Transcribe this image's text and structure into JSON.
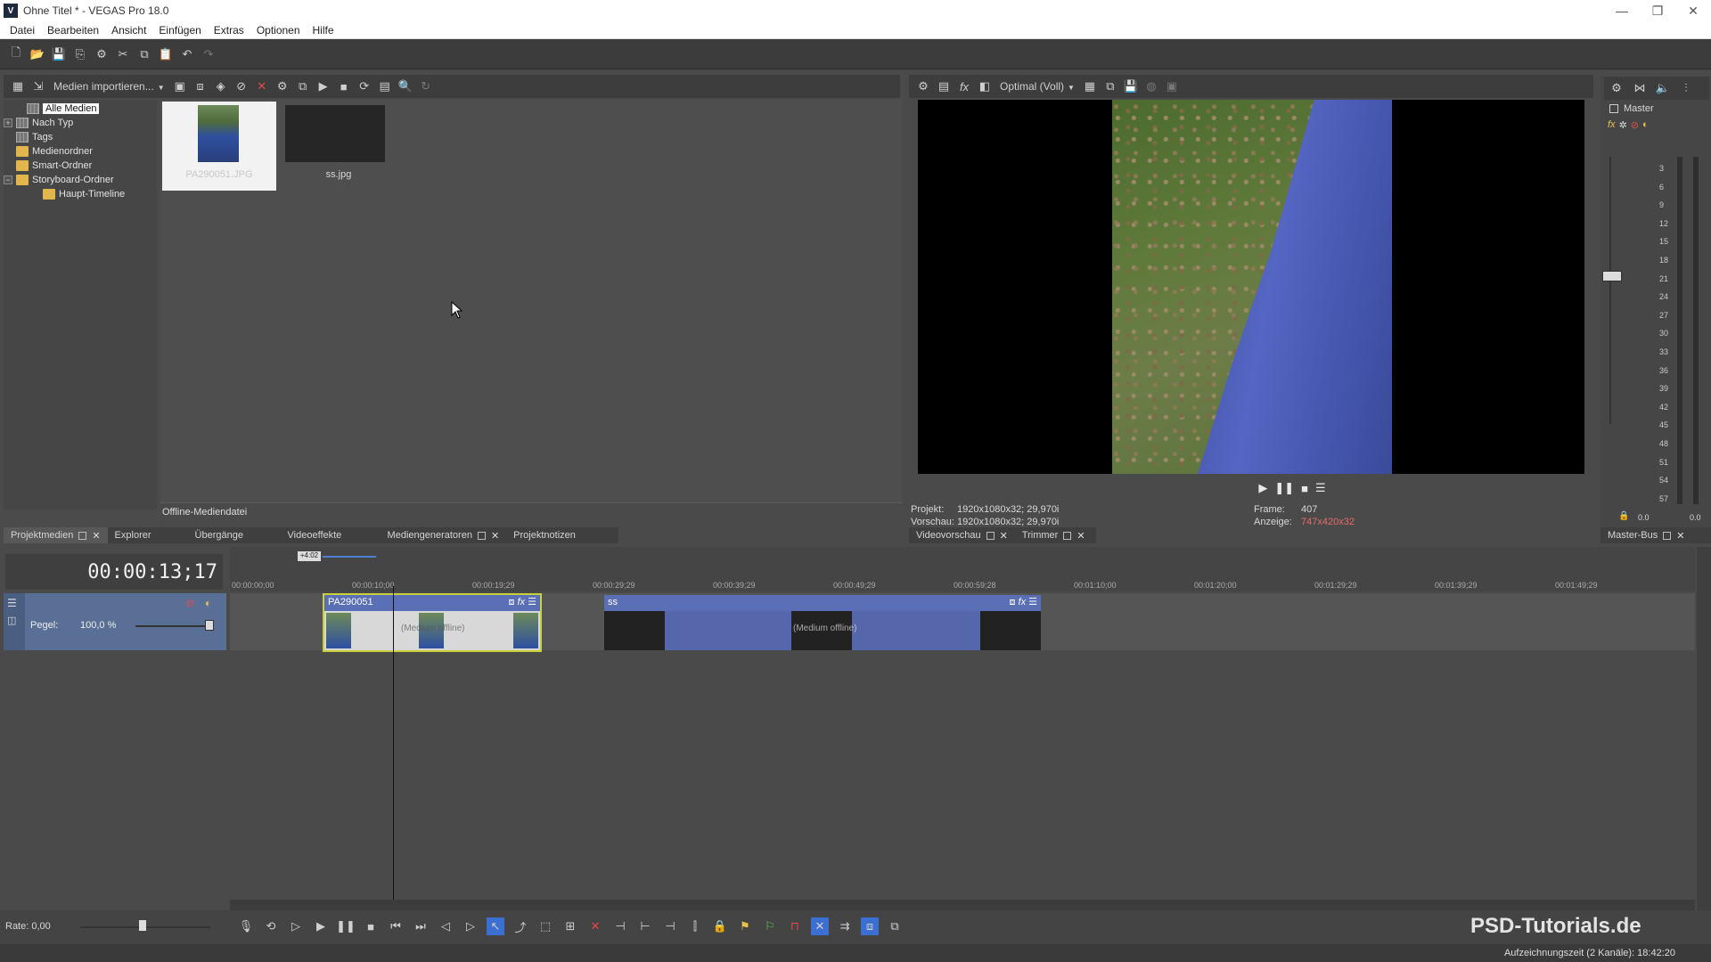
{
  "window": {
    "title": "Ohne Titel * - VEGAS Pro 18.0",
    "app_icon": "V",
    "controls": [
      "minimize-icon",
      "restore-icon",
      "close-icon"
    ]
  },
  "menu": [
    "Datei",
    "Bearbeiten",
    "Ansicht",
    "Einfügen",
    "Extras",
    "Optionen",
    "Hilfe"
  ],
  "project_media": {
    "import_label": "Medien importieren...",
    "tree": [
      {
        "label": "Alle Medien",
        "selected": true,
        "expander": ""
      },
      {
        "label": "Nach Typ",
        "expander": "+"
      },
      {
        "label": "Tags",
        "expander": ""
      },
      {
        "label": "Medienordner",
        "expander": ""
      },
      {
        "label": "Smart-Ordner",
        "expander": ""
      },
      {
        "label": "Storyboard-Ordner",
        "expander": "−"
      },
      {
        "label": "Haupt-Timeline",
        "expander": ""
      }
    ],
    "thumbs": [
      {
        "label": "PA290051.JPG"
      },
      {
        "label": "ss.jpg"
      }
    ],
    "status": "Offline-Mediendatei"
  },
  "left_tabs": [
    {
      "label": "Projektmedien",
      "active": true
    },
    {
      "label": "Explorer"
    },
    {
      "label": "Übergänge"
    },
    {
      "label": "Videoeffekte"
    },
    {
      "label": "Mediengeneratoren"
    },
    {
      "label": "Projektnotizen"
    }
  ],
  "preview": {
    "quality": "Optimal (Voll)",
    "projekt_label": "Projekt:",
    "projekt_value": "1920x1080x32; 29,970i",
    "vorschau_label": "Vorschau:",
    "vorschau_value": "1920x1080x32; 29,970i",
    "frame_label": "Frame:",
    "frame_value": "407",
    "anzeige_label": "Anzeige:",
    "anzeige_value": "747x420x32",
    "colors": {
      "anzeige": "#e86a6a"
    }
  },
  "preview_tabs": [
    {
      "label": "Videovorschau"
    },
    {
      "label": "Trimmer"
    }
  ],
  "master": {
    "label": "Master",
    "scale": [
      "3",
      "6",
      "9",
      "12",
      "15",
      "18",
      "21",
      "24",
      "27",
      "30",
      "33",
      "36",
      "39",
      "42",
      "45",
      "48",
      "51",
      "54",
      "57"
    ],
    "left_value": "0.0",
    "right_value": "0.0",
    "tab": "Master-Bus"
  },
  "timeline": {
    "timecode": "00:00:13;17",
    "region_marker": "+4:02",
    "ruler": [
      "00:00:00;00",
      "00:00:10;00",
      "00:00:19;29",
      "00:00:29;29",
      "00:00:39;29",
      "00:00:49;29",
      "00:00:59;28",
      "00:01:10;00",
      "00:01:20;00",
      "00:01:29;29",
      "00:01:39;29",
      "00:01:49;29"
    ],
    "track": {
      "pegel_label": "Pegel:",
      "pegel_value": "100,0 %",
      "level": 1.0
    },
    "clips": [
      {
        "name": "PA290051",
        "offline": "(Medium offline)"
      },
      {
        "name": "ss",
        "offline": "(Medium offline)"
      }
    ],
    "rate_label": "Rate: 0,00"
  },
  "status": {
    "text": "Aufzeichnungszeit (2 Kanäle): 18:42:20"
  },
  "watermark": "PSD-Tutorials.de"
}
